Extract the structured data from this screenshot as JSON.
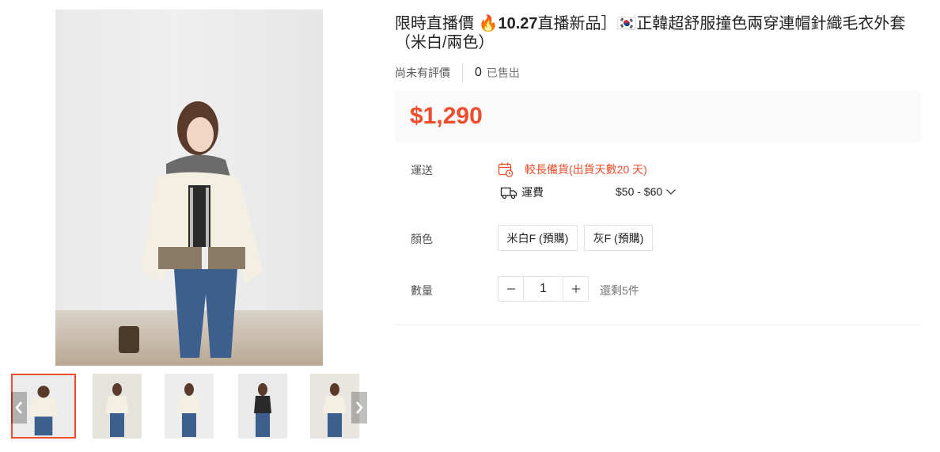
{
  "product": {
    "title_prefix": "限時直播價 🔥",
    "title_highlight": "10.27",
    "title_rest": "直播新品］🇰🇷正韓超舒服撞色兩穿連帽針織毛衣外套（米白/兩色）",
    "rating_text": "尚未有評價",
    "sold_count": "0",
    "sold_label": "已售出",
    "price": "$1,290"
  },
  "shipping": {
    "label": "運送",
    "warning": "較長備貨(出貨天數20 天)",
    "fee_label": "運費",
    "fee_range": "$50 - $60"
  },
  "color": {
    "label": "顏色",
    "options": [
      "米白F (預購)",
      "灰F (預購)"
    ]
  },
  "quantity": {
    "label": "數量",
    "value": "1",
    "stock_text": "還剩5件"
  },
  "gallery": {
    "thumbnail_count": 5,
    "active_index": 0
  },
  "colors": {
    "accent": "#ee4d2d",
    "price_bg": "#fafafa"
  },
  "icons": [
    "calendar-clock-icon",
    "truck-icon",
    "chevron-down-icon",
    "minus-icon",
    "plus-icon",
    "chevron-left-icon",
    "chevron-right-icon"
  ]
}
